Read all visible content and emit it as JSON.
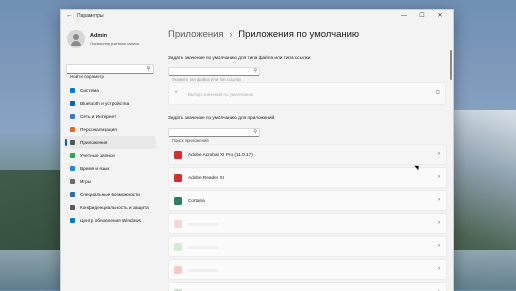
{
  "window": {
    "app_title": "Параметры",
    "controls": [
      "—",
      "☐",
      "✕"
    ]
  },
  "user": {
    "name": "Admin",
    "account_type": "Локальная учетная запись"
  },
  "sidebar": {
    "search_placeholder": "Найти параметр",
    "items": [
      {
        "label": "Система",
        "icon": "monitor-icon",
        "color": "#0078d4",
        "active": false
      },
      {
        "label": "Bluetooth и устройства",
        "icon": "bluetooth-icon",
        "color": "#0067c0",
        "active": false
      },
      {
        "label": "Сеть и Интернет",
        "icon": "wifi-icon",
        "color": "#3a7bd5",
        "active": false
      },
      {
        "label": "Персонализация",
        "icon": "brush-icon",
        "color": "#e06b2a",
        "active": false
      },
      {
        "label": "Приложения",
        "icon": "apps-icon",
        "color": "#555555",
        "active": true
      },
      {
        "label": "Учетные записи",
        "icon": "person-icon",
        "color": "#2aa64d",
        "active": false
      },
      {
        "label": "Время и язык",
        "icon": "globe-clock-icon",
        "color": "#1e88e5",
        "active": false
      },
      {
        "label": "Игры",
        "icon": "gamepad-icon",
        "color": "#6b6b6b",
        "active": false
      },
      {
        "label": "Специальные возможности",
        "icon": "accessibility-icon",
        "color": "#2b6cb0",
        "active": false
      },
      {
        "label": "Конфиденциальность и защита",
        "icon": "shield-icon",
        "color": "#5a5a5a",
        "active": false
      },
      {
        "label": "Центр обновления Windows",
        "icon": "update-icon",
        "color": "#0078d4",
        "active": false
      }
    ]
  },
  "breadcrumb": {
    "parent": "Приложения",
    "separator": "›",
    "current": "Приложения по умолчанию"
  },
  "file_type_section": {
    "label": "Задать значение по умолчанию для типа файла или типа ссылки",
    "search_placeholder": "Укажите тип файла или тип ссылки",
    "default_choice_label": "Выбор значения по умолчанию"
  },
  "apps_section": {
    "label": "Задать значение по умолчанию для приложений",
    "search_placeholder": "Поиск приложений",
    "apps": [
      {
        "name": "Adobe Acrobat XI Pro (11.0.17)",
        "icon": "acrobat-icon",
        "color": "#d32f2f"
      },
      {
        "name": "Adobe Reader XI",
        "icon": "reader-icon",
        "color": "#d32f2f"
      },
      {
        "name": "Cortana",
        "icon": "cortana-icon",
        "color": "#2e7d6b"
      },
      {
        "name": "",
        "icon": "app-icon",
        "color": "#e57373"
      },
      {
        "name": "",
        "icon": "app-icon",
        "color": "#66bb6a"
      },
      {
        "name": "",
        "icon": "app-icon",
        "color": "#e53935"
      },
      {
        "name": "",
        "icon": "app-icon",
        "color": "#43a047"
      }
    ]
  }
}
